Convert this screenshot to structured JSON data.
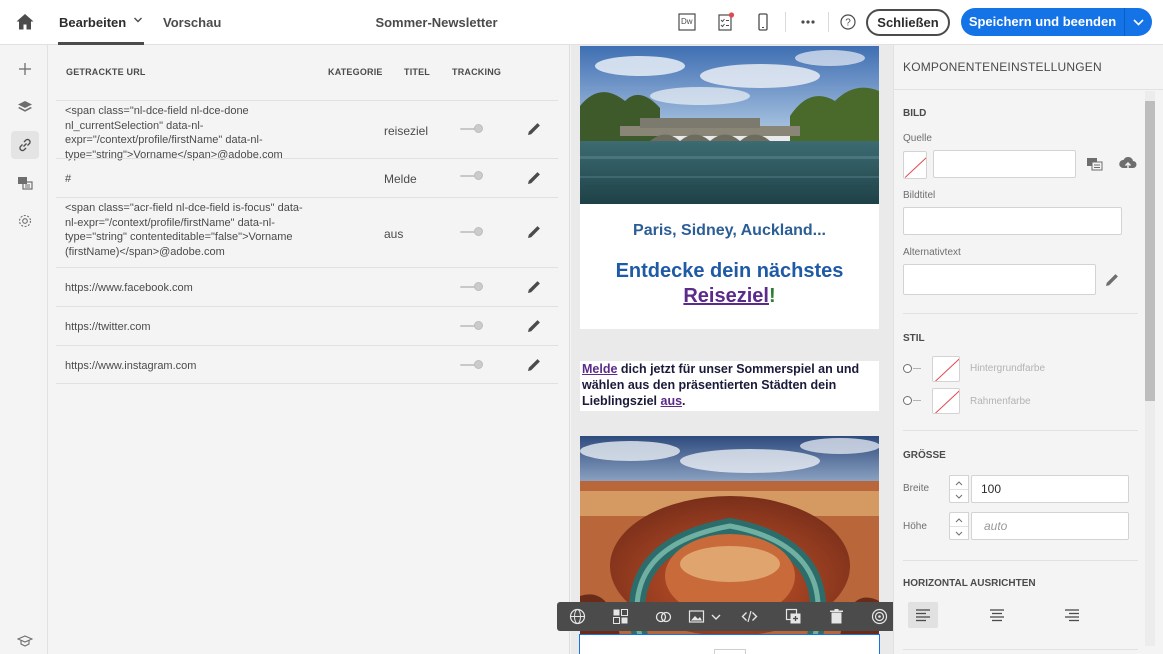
{
  "topbar": {
    "tab_edit": "Bearbeiten",
    "tab_preview": "Vorschau",
    "doc_title": "Sommer-Newsletter",
    "dw_label": "Dw",
    "close_label": "Schließen",
    "save_label": "Speichern und beenden"
  },
  "links_table": {
    "headers": {
      "url": "GETRACKTE URL",
      "category": "KATEGORIE",
      "title": "TITEL",
      "tracking": "TRACKING"
    },
    "rows": [
      {
        "url": "<span class=\"nl-dce-field nl-dce-done nl_currentSelection\" data-nl-expr=\"/context/profile/firstName\" data-nl-type=\"string\">Vorname</span>@adobe.com",
        "category": "reiseziel"
      },
      {
        "url": "#",
        "category": "Melde"
      },
      {
        "url": "<span class=\"acr-field nl-dce-field is-focus\" data-nl-expr=\"/context/profile/firstName\" data-nl-type=\"string\" contenteditable=\"false\">Vorname (firstName)</span>@adobe.com",
        "category": "aus"
      },
      {
        "url": "https://www.facebook.com",
        "category": ""
      },
      {
        "url": "https://twitter.com",
        "category": ""
      },
      {
        "url": "https://www.instagram.com",
        "category": ""
      }
    ]
  },
  "email": {
    "subtitle": "Paris, Sidney, Auckland...",
    "title_pre": "Entdecke dein nächstes",
    "title_link": "Reiseziel",
    "title_excl": "!",
    "body_link1": "Melde",
    "body_mid": " dich jetzt für unser Sommerspiel an und wählen aus den präsentierten Städten dein Lieblingsziel ",
    "body_link2": "aus",
    "body_end": "."
  },
  "settings": {
    "title": "KOMPONENTENEINSTELLUNGEN",
    "section_image": "BILD",
    "label_source": "Quelle",
    "label_img_title": "Bildtitel",
    "label_alt": "Alternativtext",
    "section_style": "STIL",
    "label_bg": "Hintergrundfarbe",
    "label_border": "Rahmenfarbe",
    "section_size": "GRÖSSE",
    "label_width": "Breite",
    "width_value": "100",
    "label_height": "Höhe",
    "height_placeholder": "auto",
    "section_halign": "HORIZONTAL AUSRICHTEN"
  },
  "colors": {
    "accent": "#1473e6",
    "email_title": "#1f5aa6",
    "email_link": "#5b2a8a",
    "swatch_none": "#e34850"
  }
}
